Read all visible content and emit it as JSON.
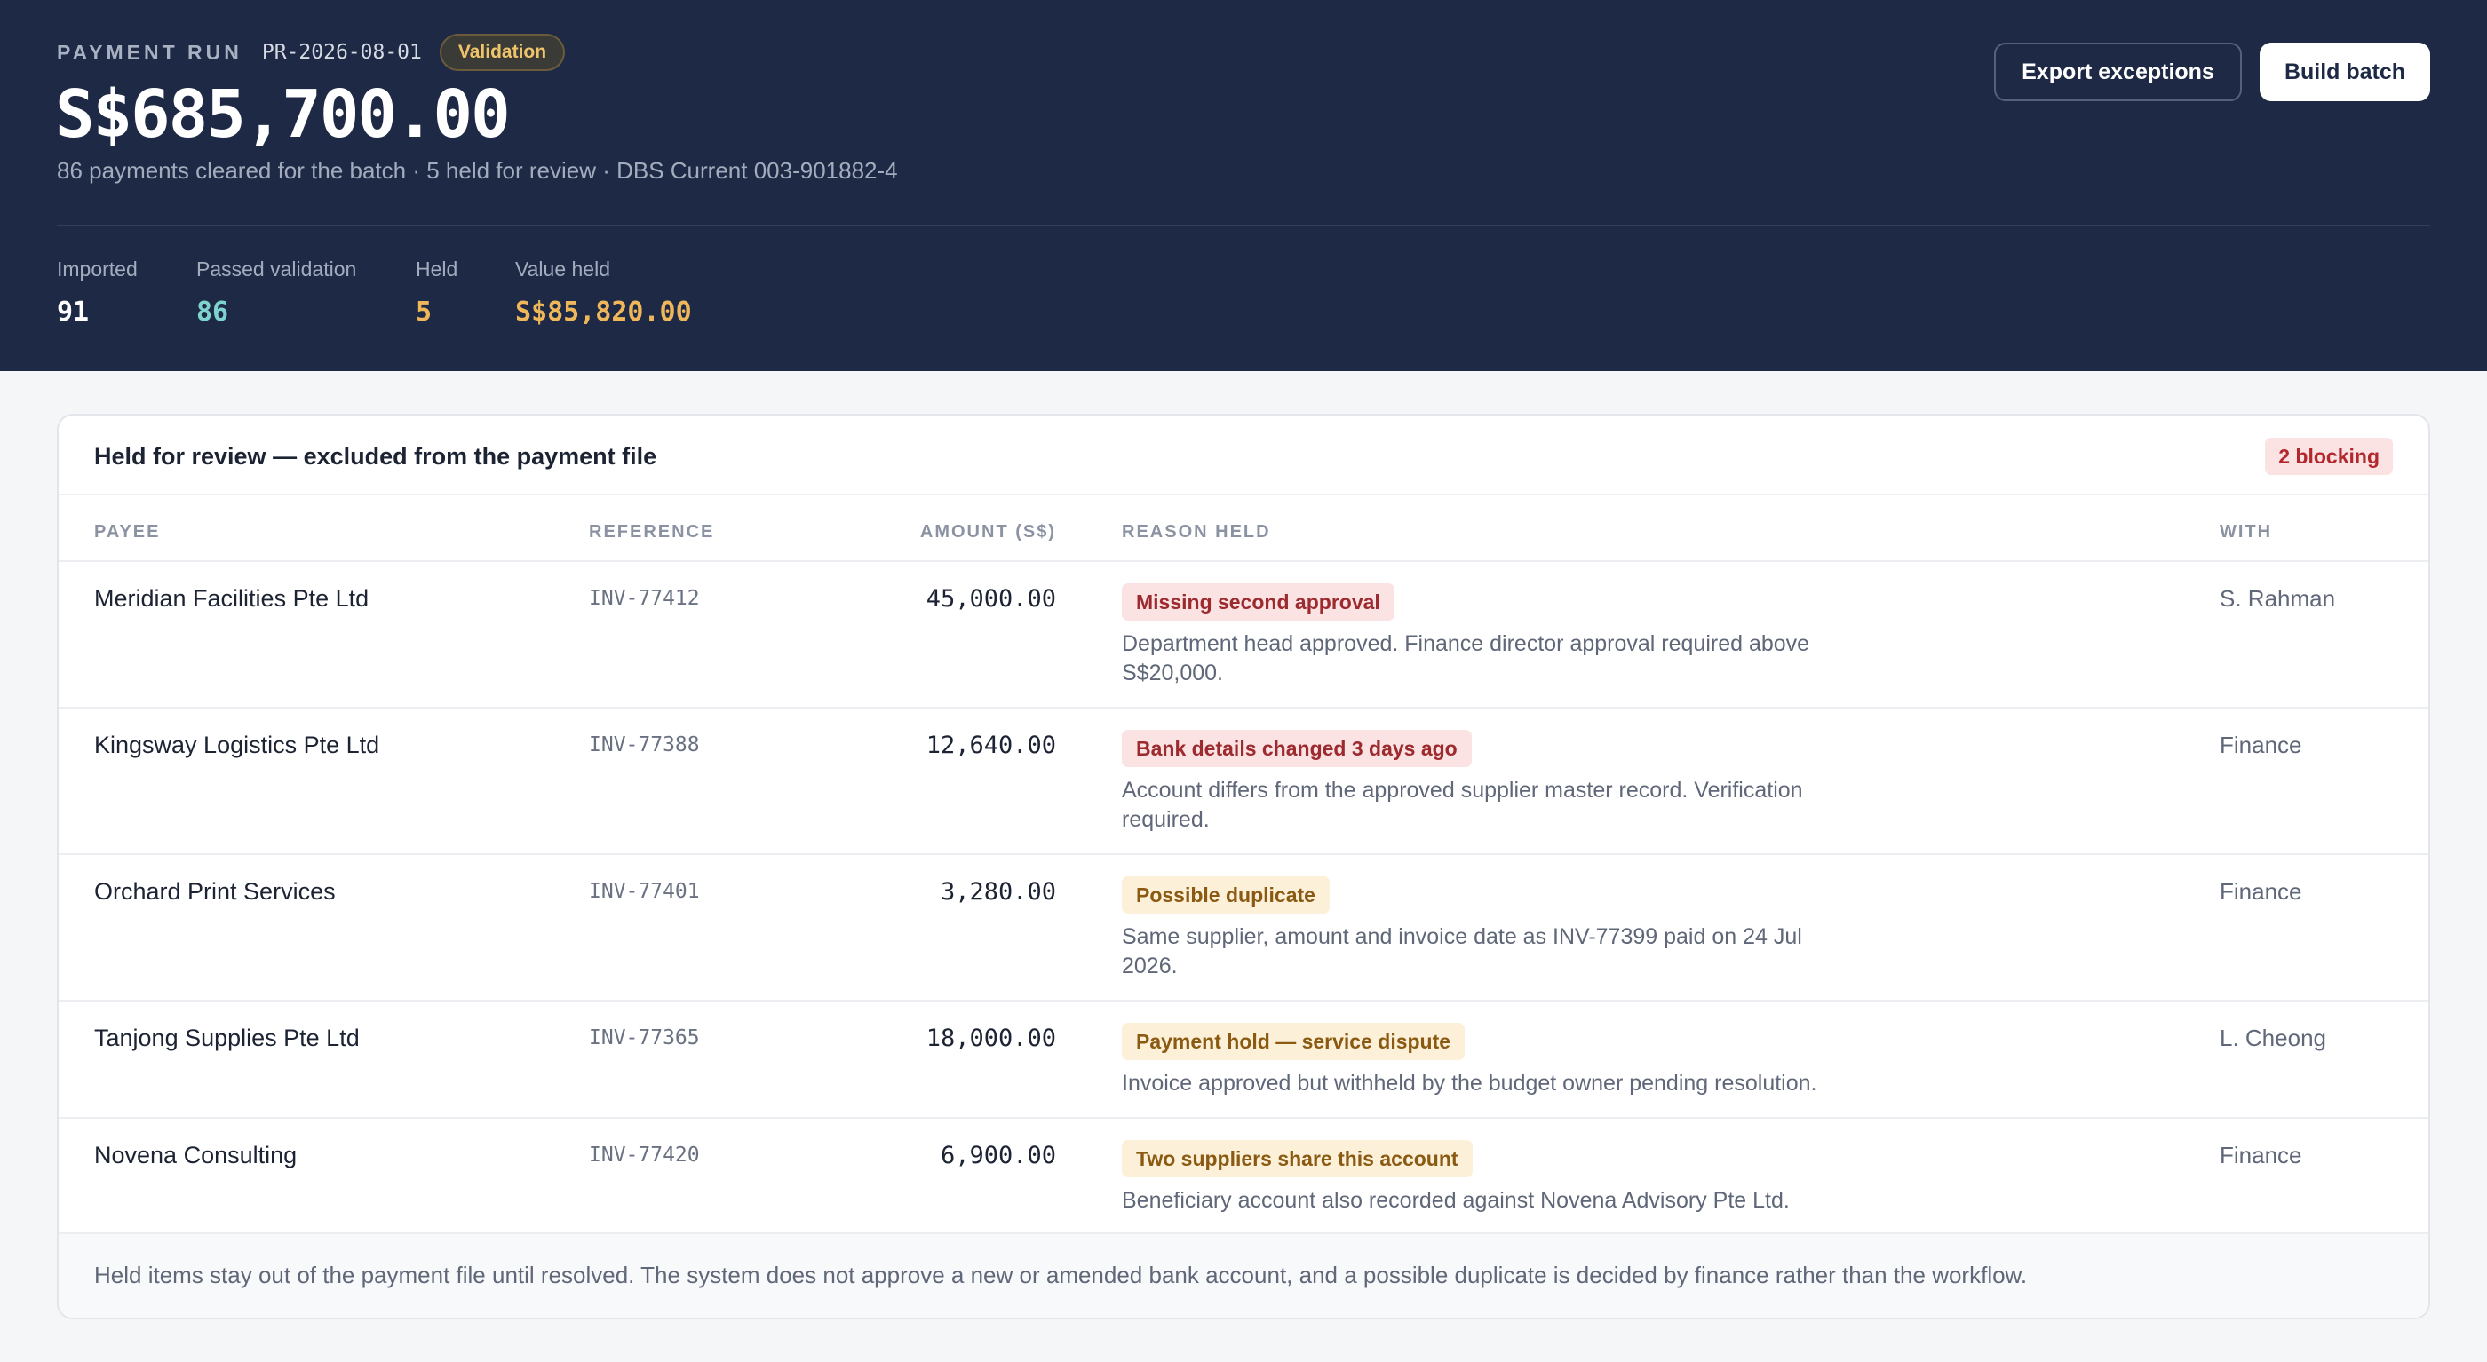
{
  "header": {
    "run_label": "PAYMENT RUN",
    "run_id": "PR-2026-08-01",
    "status_badge": "Validation",
    "total": "S$685,700.00",
    "summary": "86 payments cleared for the batch · 5 held for review · DBS Current 003-901882-4",
    "export_label": "Export exceptions",
    "build_label": "Build batch"
  },
  "stats": [
    {
      "label": "Imported",
      "value": "91",
      "color": "#ffffff"
    },
    {
      "label": "Passed validation",
      "value": "86",
      "color": "#7fd3cf"
    },
    {
      "label": "Held",
      "value": "5",
      "color": "#f0b75a"
    },
    {
      "label": "Value held",
      "value": "S$85,820.00",
      "color": "#f0b75a"
    }
  ],
  "held": {
    "title": "Held for review — excluded from the payment file",
    "blocking": "2 blocking",
    "columns": {
      "payee": "PAYEE",
      "reference": "REFERENCE",
      "amount": "AMOUNT (S$)",
      "reason": "REASON HELD",
      "with": "WITH"
    },
    "rows": [
      {
        "payee": "Meridian Facilities Pte Ltd",
        "reference": "INV-77412",
        "amount": "45,000.00",
        "tag": "Missing second approval",
        "tag_color": "red",
        "detail": "Department head approved. Finance director approval required above S$20,000.",
        "with": "S. Rahman"
      },
      {
        "payee": "Kingsway Logistics Pte Ltd",
        "reference": "INV-77388",
        "amount": "12,640.00",
        "tag": "Bank details changed 3 days ago",
        "tag_color": "red",
        "detail": "Account differs from the approved supplier master record. Verification required.",
        "with": "Finance"
      },
      {
        "payee": "Orchard Print Services",
        "reference": "INV-77401",
        "amount": "3,280.00",
        "tag": "Possible duplicate",
        "tag_color": "amber",
        "detail": "Same supplier, amount and invoice date as INV-77399 paid on 24 Jul 2026.",
        "with": "Finance"
      },
      {
        "payee": "Tanjong Supplies Pte Ltd",
        "reference": "INV-77365",
        "amount": "18,000.00",
        "tag": "Payment hold — service dispute",
        "tag_color": "amber",
        "detail": "Invoice approved but withheld by the budget owner pending resolution.",
        "with": "L. Cheong"
      },
      {
        "payee": "Novena Consulting",
        "reference": "INV-77420",
        "amount": "6,900.00",
        "tag": "Two suppliers share this account",
        "tag_color": "amber",
        "detail": "Beneficiary account also recorded against Novena Advisory Pte Ltd.",
        "with": "Finance"
      }
    ],
    "footer": "Held items stay out of the payment file until resolved. The system does not approve a new or amended bank account, and a possible duplicate is decided by finance rather than the workflow."
  }
}
